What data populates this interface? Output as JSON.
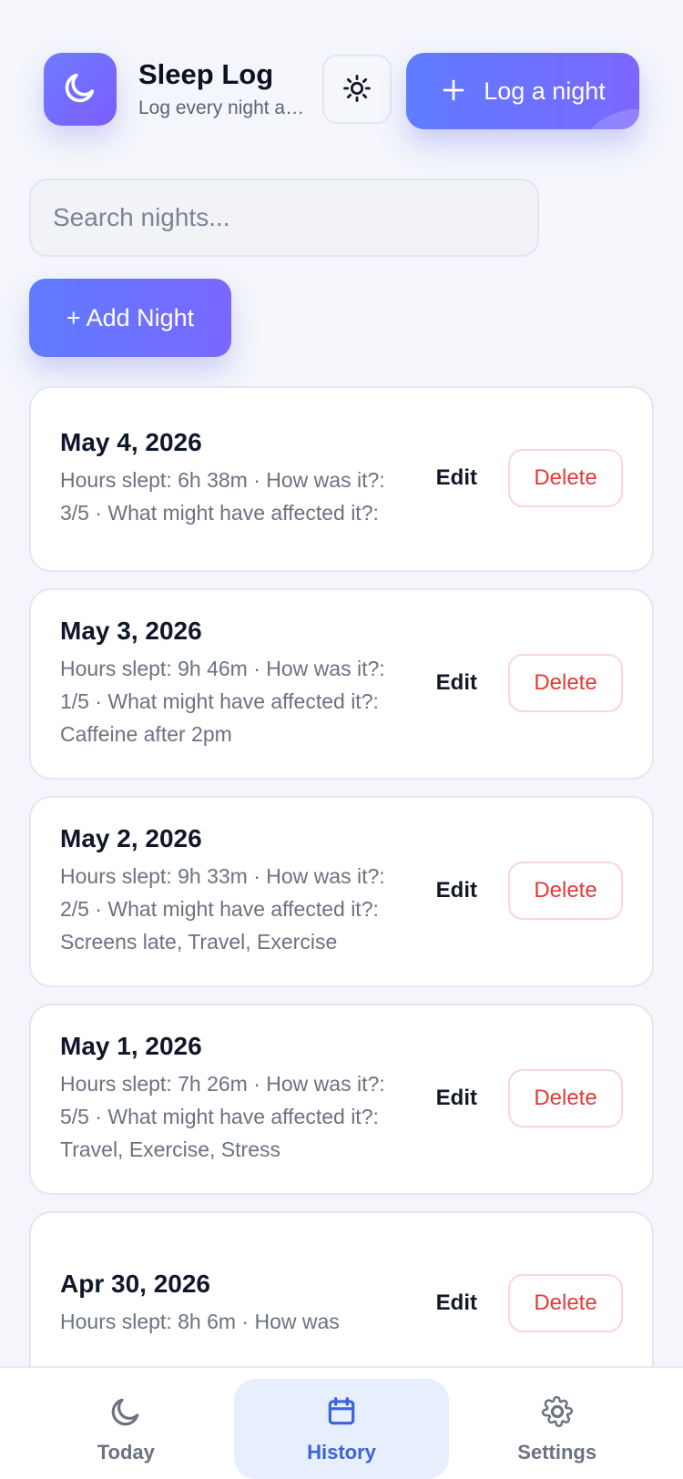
{
  "header": {
    "title": "Sleep Log",
    "subtitle": "Log every night and see your patterns",
    "log_button_label": "Log a night"
  },
  "search": {
    "placeholder": "Search nights..."
  },
  "actions": {
    "add_night_label": "+ Add Night",
    "edit_label": "Edit",
    "delete_label": "Delete"
  },
  "nights": [
    {
      "date": "May 4, 2026",
      "details": "Hours slept: 6h 38m · How was it?: 3/5 · What might have affected it?:"
    },
    {
      "date": "May 3, 2026",
      "details": "Hours slept: 9h 46m · How was it?: 1/5 · What might have affected it?: Caffeine after 2pm"
    },
    {
      "date": "May 2, 2026",
      "details": "Hours slept: 9h 33m · How was it?: 2/5 · What might have affected it?: Screens late, Travel, Exercise"
    },
    {
      "date": "May 1, 2026",
      "details": "Hours slept: 7h 26m · How was it?: 5/5 · What might have affected it?: Travel, Exercise, Stress"
    },
    {
      "date": "Apr 30, 2026",
      "details": "Hours slept: 8h 6m · How was"
    }
  ],
  "nav": {
    "today": "Today",
    "history": "History",
    "settings": "Settings"
  },
  "icons": {
    "app": "moon-icon",
    "theme": "sun-icon",
    "plus": "plus-icon",
    "today": "moon-icon",
    "history": "calendar-icon",
    "settings": "gear-icon"
  },
  "colors": {
    "accent": "#6d7cff",
    "accent_2": "#7b5cff",
    "danger": "#e53935",
    "active_nav": "#3d63d8",
    "active_nav_bg": "#e7eefc"
  }
}
